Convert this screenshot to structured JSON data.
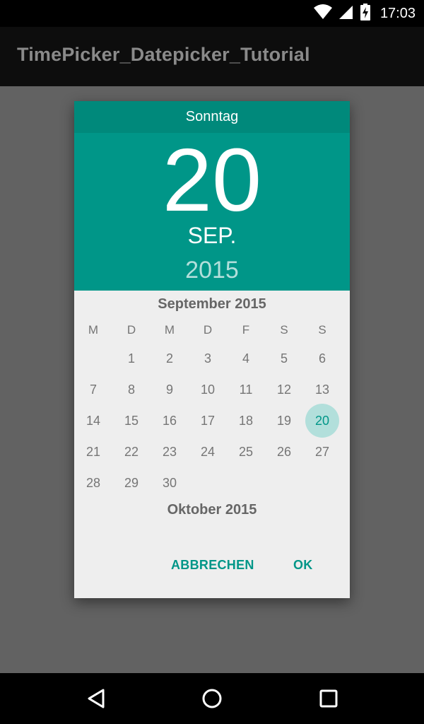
{
  "status_bar": {
    "time": "17:03",
    "icons": [
      "wifi-icon",
      "signal-icon",
      "battery-charging-icon"
    ]
  },
  "app_bar": {
    "title": "TimePicker_Datepicker_Tutorial"
  },
  "dialog": {
    "header": {
      "weekday": "Sonntag",
      "day": "20",
      "month": "SEP.",
      "year": "2015"
    },
    "calendar": {
      "month_title": "September 2015",
      "next_month_title": "Oktober 2015",
      "weekday_labels": [
        "M",
        "D",
        "M",
        "D",
        "F",
        "S",
        "S"
      ],
      "weeks": [
        [
          "",
          "1",
          "2",
          "3",
          "4",
          "5",
          "6"
        ],
        [
          "7",
          "8",
          "9",
          "10",
          "11",
          "12",
          "13"
        ],
        [
          "14",
          "15",
          "16",
          "17",
          "18",
          "19",
          "20"
        ],
        [
          "21",
          "22",
          "23",
          "24",
          "25",
          "26",
          "27"
        ],
        [
          "28",
          "29",
          "30",
          "",
          "",
          "",
          ""
        ]
      ],
      "selected_day": "20"
    },
    "actions": {
      "cancel_label": "ABBRECHEN",
      "ok_label": "OK"
    }
  },
  "nav_bar": {
    "icons": [
      "back-icon",
      "home-icon",
      "recents-icon"
    ]
  },
  "colors": {
    "accent": "#009688",
    "header_dark": "#00897b",
    "selected_circle": "#b2dfdb",
    "dialog_bg": "#eeeeee",
    "scrim": "#626262"
  }
}
